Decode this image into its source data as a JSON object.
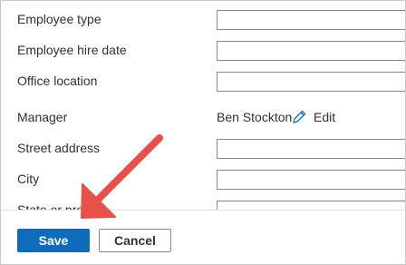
{
  "form": {
    "rows": [
      {
        "label": "Employee type",
        "value": ""
      },
      {
        "label": "Employee hire date",
        "value": ""
      },
      {
        "label": "Office location",
        "value": ""
      },
      {
        "label": "Manager",
        "value": "Ben Stockton"
      },
      {
        "label": "Street address",
        "value": ""
      },
      {
        "label": "City",
        "value": ""
      },
      {
        "label": "State or prov",
        "value": ""
      }
    ],
    "manager_edit_label": "Edit",
    "edit_icon": "pencil-icon"
  },
  "footer": {
    "save_label": "Save",
    "cancel_label": "Cancel"
  },
  "colors": {
    "primary": "#0f6cbd",
    "annotation_arrow": "#e8504a",
    "edit_icon": "#0f6cbd"
  }
}
